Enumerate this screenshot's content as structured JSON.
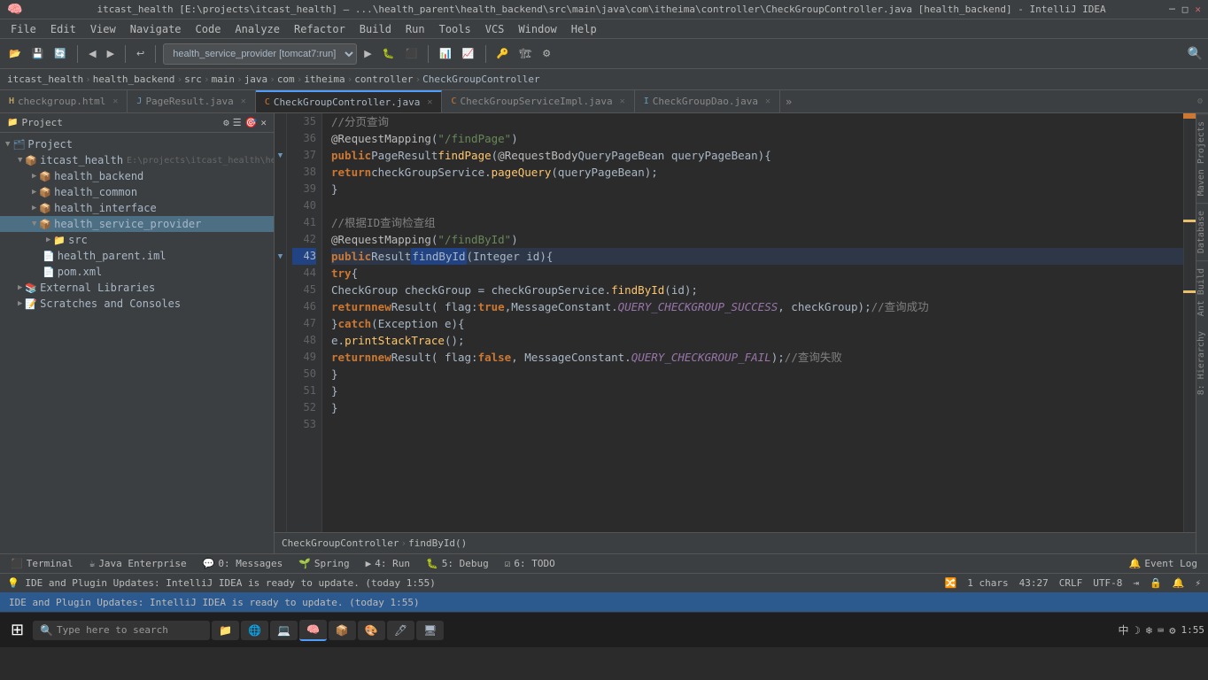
{
  "window": {
    "title": "itcast_health [E:\\projects\\itcast_health] – ...\\health_parent\\health_backend\\src\\main\\java\\com\\itheima\\controller\\CheckGroupController.java [health_backend] - IntelliJ IDEA"
  },
  "menuBar": {
    "items": [
      "File",
      "Edit",
      "View",
      "Navigate",
      "Code",
      "Analyze",
      "Refactor",
      "Build",
      "Run",
      "Tools",
      "VCS",
      "Window",
      "Help"
    ]
  },
  "toolbar": {
    "runConfig": "health_service_provider [tomcat7:run]",
    "searchPlaceholder": "Search"
  },
  "breadcrumb": {
    "items": [
      "itcast_health",
      "health_backend",
      "src",
      "main",
      "java",
      "com",
      "itheima",
      "controller",
      "CheckGroupController"
    ]
  },
  "tabs": [
    {
      "label": "checkgroup.html",
      "icon": "html",
      "active": false,
      "closable": true
    },
    {
      "label": "PageResult.java",
      "icon": "java",
      "active": false,
      "closable": true
    },
    {
      "label": "CheckGroupController.java",
      "icon": "java",
      "active": true,
      "closable": true
    },
    {
      "label": "CheckGroupServiceImpl.java",
      "icon": "java",
      "active": false,
      "closable": true
    },
    {
      "label": "CheckGroupDao.java",
      "icon": "java",
      "active": false,
      "closable": true
    }
  ],
  "sidebar": {
    "title": "Project",
    "tree": [
      {
        "indent": 0,
        "type": "project",
        "label": "Project",
        "expanded": true,
        "icon": "📁"
      },
      {
        "indent": 1,
        "type": "folder",
        "label": "itcast_health",
        "path": "E:\\projects\\itcast_health\\he",
        "expanded": true,
        "icon": "📁"
      },
      {
        "indent": 2,
        "type": "module",
        "label": "health_backend",
        "expanded": false,
        "icon": "📦"
      },
      {
        "indent": 2,
        "type": "module",
        "label": "health_common",
        "expanded": false,
        "icon": "📦"
      },
      {
        "indent": 2,
        "type": "module",
        "label": "health_interface",
        "expanded": false,
        "icon": "📦"
      },
      {
        "indent": 2,
        "type": "module",
        "label": "health_service_provider",
        "expanded": true,
        "icon": "📦",
        "selected": true
      },
      {
        "indent": 3,
        "type": "folder",
        "label": "src",
        "expanded": false,
        "icon": "📁"
      },
      {
        "indent": 2,
        "type": "file",
        "label": "health_parent.iml",
        "icon": "📄"
      },
      {
        "indent": 2,
        "type": "file",
        "label": "pom.xml",
        "icon": "📄"
      },
      {
        "indent": 1,
        "type": "folder",
        "label": "External Libraries",
        "expanded": false,
        "icon": "📚"
      },
      {
        "indent": 1,
        "type": "folder",
        "label": "Scratches and Consoles",
        "expanded": false,
        "icon": "📝"
      }
    ]
  },
  "code": {
    "lines": [
      {
        "num": 35,
        "content": "    //分页查询",
        "type": "comment"
      },
      {
        "num": 36,
        "content": "    @RequestMapping(\"/findPage\")",
        "type": "anno"
      },
      {
        "num": 37,
        "content": "    public PageResult findPage(@RequestBody QueryPageBean queryPageBean){",
        "type": "code"
      },
      {
        "num": 38,
        "content": "        return checkGroupService.pageQuery(queryPageBean);",
        "type": "code"
      },
      {
        "num": 39,
        "content": "    }",
        "type": "code"
      },
      {
        "num": 40,
        "content": "",
        "type": "empty"
      },
      {
        "num": 41,
        "content": "    //根据ID查询检查组",
        "type": "comment"
      },
      {
        "num": 42,
        "content": "    @RequestMapping(\"/findById\")",
        "type": "anno"
      },
      {
        "num": 43,
        "content": "    public Result findById(Integer id){",
        "type": "code",
        "highlight": true,
        "selected": "findById"
      },
      {
        "num": 44,
        "content": "        try{",
        "type": "code"
      },
      {
        "num": 45,
        "content": "            CheckGroup checkGroup = checkGroupService.findById(id);",
        "type": "code"
      },
      {
        "num": 46,
        "content": "            return new Result( flag: true,MessageConstant.QUERY_CHECKGROUP_SUCCESS, checkGroup); //查询成功",
        "type": "code"
      },
      {
        "num": 47,
        "content": "        }catch (Exception e){",
        "type": "code"
      },
      {
        "num": 48,
        "content": "            e.printStackTrace();",
        "type": "code"
      },
      {
        "num": 49,
        "content": "            return new Result( flag: false, MessageConstant.QUERY_CHECKGROUP_FAIL); //查询失败",
        "type": "code"
      },
      {
        "num": 50,
        "content": "        }",
        "type": "code"
      },
      {
        "num": 51,
        "content": "    }",
        "type": "code"
      },
      {
        "num": 52,
        "content": "}",
        "type": "code"
      },
      {
        "num": 53,
        "content": "",
        "type": "empty"
      }
    ]
  },
  "statusBar": {
    "message": "IDE and Plugin Updates: IntelliJ IDEA is ready to update. (today 1:55)",
    "chars": "1 chars",
    "position": "43:27",
    "lineEnding": "CRLF",
    "encoding": "UTF-8",
    "icons": [
      "🔔",
      "🔒"
    ]
  },
  "breadcrumbBottom": {
    "items": [
      "CheckGroupController",
      "findById()"
    ]
  },
  "bottomTabs": [
    {
      "label": "Terminal",
      "icon": "▶",
      "active": false
    },
    {
      "label": "Java Enterprise",
      "icon": "☕",
      "active": false
    },
    {
      "label": "0: Messages",
      "icon": "💬",
      "active": false
    },
    {
      "label": "Spring",
      "icon": "🌱",
      "active": false
    },
    {
      "label": "4: Run",
      "icon": "▶",
      "active": false
    },
    {
      "label": "5: Debug",
      "icon": "🐛",
      "active": false
    },
    {
      "label": "6: TODO",
      "icon": "✓",
      "active": false
    }
  ],
  "eventLog": {
    "label": "Event Log"
  },
  "rightPanels": [
    {
      "label": "Maven Projects"
    },
    {
      "label": "Database"
    },
    {
      "label": "Ant Build"
    },
    {
      "label": "8: Hierarchy"
    }
  ],
  "taskbar": {
    "startIcon": "⊞",
    "apps": [
      "🖥",
      "📁",
      "🌐",
      "💻",
      "🎯",
      "📦",
      "🎨",
      "🖊"
    ],
    "timeArea": "中 ☽ ❄ ⌨ ⚙"
  }
}
